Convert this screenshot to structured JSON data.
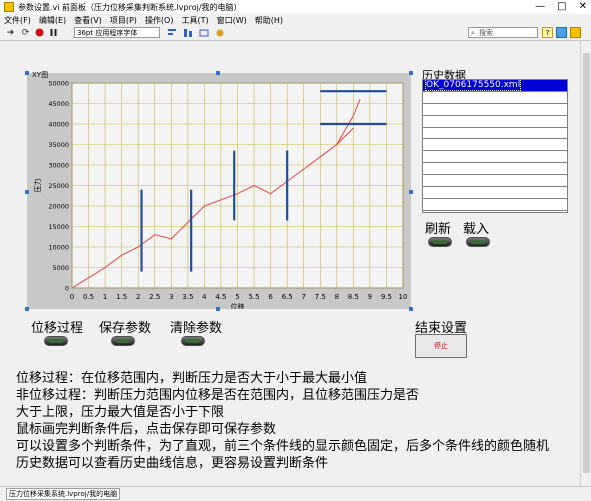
{
  "window": {
    "title": "参数设置.vi 前面板（压力位移采集判断系统.lvproj/我的电脑）",
    "controls": [
      "—",
      "□",
      "✕"
    ]
  },
  "menu": {
    "items": [
      "文件(F)",
      "编辑(E)",
      "查看(V)",
      "项目(P)",
      "操作(O)",
      "工具(T)",
      "窗口(W)",
      "帮助(H)"
    ]
  },
  "toolbar": {
    "font": "36pt 应用程序字体",
    "search_placeholder": "搜索",
    "help_icon": "?"
  },
  "graph": {
    "legend": "XY图",
    "accent_color": "#1f4e9c",
    "curve_color": "#ee4040"
  },
  "chart_data": {
    "type": "line",
    "title": "",
    "xlabel": "位移",
    "ylabel": "压力",
    "xlim": [
      0,
      10
    ],
    "ylim": [
      0,
      50000
    ],
    "xticks": [
      "0",
      "0.5",
      "1",
      "1.5",
      "2",
      "2.5",
      "3",
      "3.5",
      "4",
      "4.5",
      "5",
      "5.5",
      "6",
      "6.5",
      "7",
      "7.5",
      "8",
      "8.5",
      "9",
      "9.5",
      "10"
    ],
    "yticks": [
      "0",
      "5000",
      "10000",
      "15000",
      "20000",
      "25000",
      "30000",
      "35000",
      "40000",
      "45000",
      "50000"
    ],
    "grid": true,
    "series": [
      {
        "x": [
          0,
          0.5,
          1,
          1.5,
          2,
          2.5,
          3,
          3.5,
          4,
          4.5,
          5,
          5.5,
          6,
          6.5,
          7,
          7.5,
          8,
          8.5
        ],
        "y": [
          0,
          2500,
          5000,
          8000,
          10000,
          13000,
          12000,
          16000,
          20000,
          21500,
          23000,
          25000,
          23000,
          26000,
          29000,
          32000,
          35000,
          39000
        ]
      },
      {
        "x": [
          8,
          8.5,
          8.7
        ],
        "y": [
          35000,
          42000,
          46000
        ]
      }
    ],
    "judge_lines": [
      {
        "x1": 2.1,
        "y1": 4000,
        "x2": 2.1,
        "y2": 24000
      },
      {
        "x1": 3.6,
        "y1": 4000,
        "x2": 3.6,
        "y2": 24000
      },
      {
        "x1": 4.9,
        "y1": 16500,
        "x2": 4.9,
        "y2": 33500
      },
      {
        "x1": 6.5,
        "y1": 16500,
        "x2": 6.5,
        "y2": 33500
      },
      {
        "x1": 7.5,
        "y1": 48000,
        "x2": 9.5,
        "y2": 48000
      },
      {
        "x1": 7.5,
        "y1": 40000,
        "x2": 9.5,
        "y2": 40000
      }
    ]
  },
  "history": {
    "label": "历史数据",
    "items": [
      "OK_0706175550.xml",
      "",
      "",
      "",
      "",
      "",
      "",
      "",
      "",
      "",
      ""
    ],
    "selected_index": 0
  },
  "buttons": {
    "refresh": "刷新",
    "load": "载入",
    "move_process": "位移过程",
    "save_params": "保存参数",
    "clear_params": "清除参数",
    "end_settings": "结束设置",
    "stop": "停止"
  },
  "description": [
    "位移过程：在位移范围内，判断压力是否大于小于最大最小值",
    "非位移过程：判断压力范围内位移是否在范围内，且位移范围压力是否",
    "大于上限，压力最大值是否小于下限",
    "鼠标画完判断条件后，点击保存即可保存参数",
    "可以设置多个判断条件，为了直观，前三个条件线的显示颜色固定，后多个条件线的颜色随机",
    "历史数据可以查看历史曲线信息，更容易设置判断条件"
  ],
  "status": {
    "project": "压力位移采集系统.lvproj/我的电脑"
  }
}
